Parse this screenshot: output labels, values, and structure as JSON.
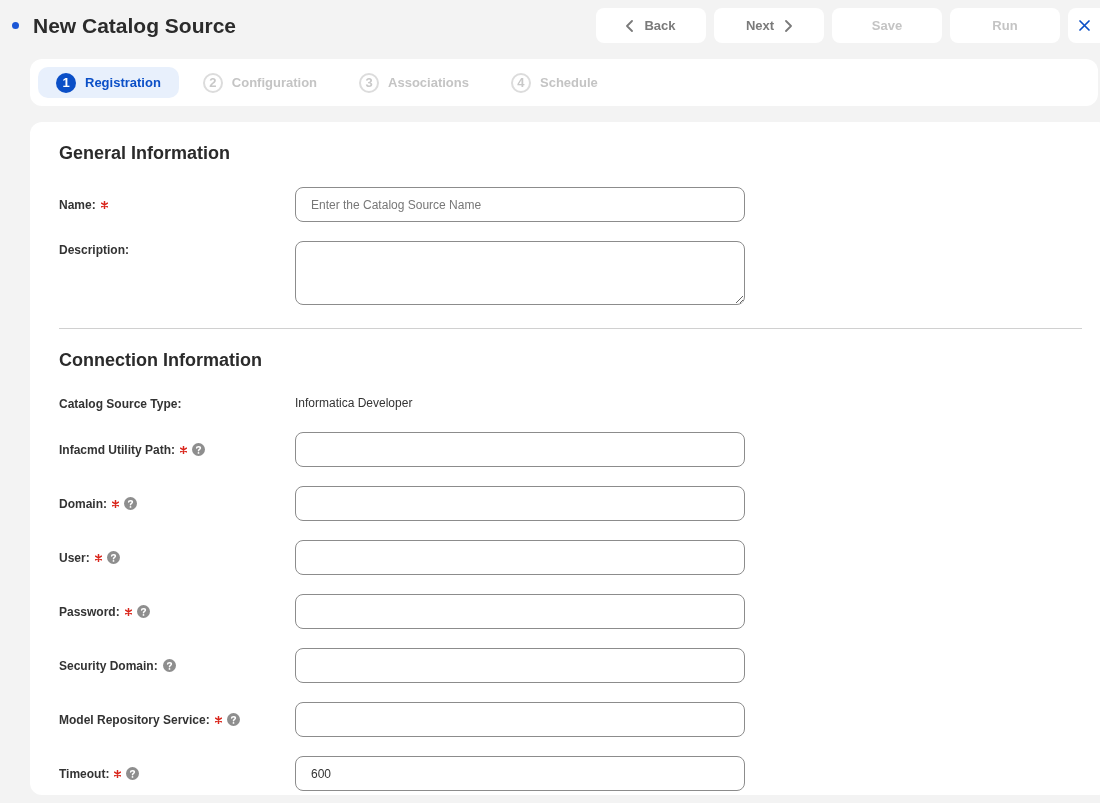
{
  "header": {
    "title": "New Catalog Source",
    "buttons": [
      {
        "label": "Back",
        "kind": "back",
        "disabled": false
      },
      {
        "label": "Next",
        "kind": "next",
        "disabled": false
      },
      {
        "label": "Save",
        "kind": "plain",
        "disabled": true
      },
      {
        "label": "Run",
        "kind": "plain",
        "disabled": true
      }
    ]
  },
  "steps": [
    {
      "number": "1",
      "label": "Registration",
      "selected": true
    },
    {
      "number": "2",
      "label": "Configuration",
      "selected": false
    },
    {
      "number": "3",
      "label": "Associations",
      "selected": false
    },
    {
      "number": "4",
      "label": "Schedule",
      "selected": false
    }
  ],
  "sections": [
    {
      "title": "General Information",
      "fields": [
        {
          "label": "Name:",
          "kind": "input",
          "required": true,
          "help": false,
          "placeholder": "Enter the Catalog Source Name"
        },
        {
          "label": "Description:",
          "kind": "textarea",
          "required": false,
          "help": false
        }
      ]
    },
    {
      "title": "Connection Information",
      "fields": [
        {
          "label": "Catalog Source Type:",
          "kind": "text",
          "required": false,
          "help": false,
          "value": "Informatica Developer"
        },
        {
          "label": "Infacmd Utility Path:",
          "kind": "input",
          "required": true,
          "help": true
        },
        {
          "label": "Domain:",
          "kind": "input",
          "required": true,
          "help": true
        },
        {
          "label": "User:",
          "kind": "input",
          "required": true,
          "help": true
        },
        {
          "label": "Password:",
          "kind": "input",
          "required": true,
          "help": true
        },
        {
          "label": "Security Domain:",
          "kind": "input",
          "required": false,
          "help": true
        },
        {
          "label": "Model Repository Service:",
          "kind": "input",
          "required": true,
          "help": true
        },
        {
          "label": "Timeout:",
          "kind": "input",
          "required": true,
          "help": true,
          "value": "600"
        }
      ]
    }
  ]
}
